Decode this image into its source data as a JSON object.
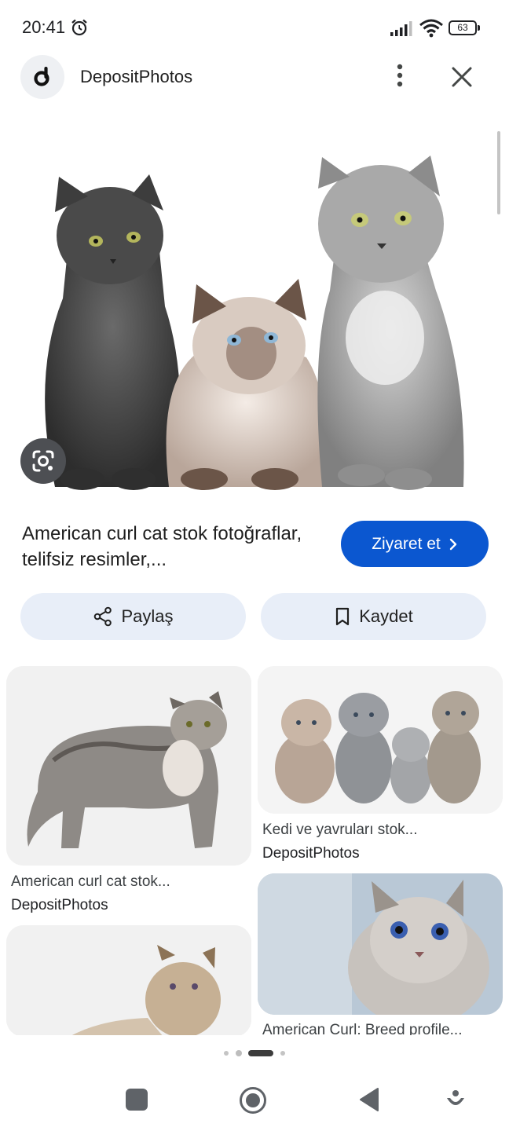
{
  "status_bar": {
    "time": "20:41",
    "battery": "63"
  },
  "header": {
    "site_name": "DepositPhotos",
    "logo_letter": "d"
  },
  "result": {
    "title": "American curl cat stok fotoğraflar, telifsiz resimler,...",
    "visit_label": "Ziyaret et",
    "share_label": "Paylaş",
    "save_label": "Kaydet"
  },
  "related": [
    {
      "title": "American curl cat stok...",
      "source": "DepositPhotos"
    },
    {
      "title": "Kedi ve yavruları stok...",
      "source": "DepositPhotos"
    },
    {
      "title": "American Curl: Breed profile...",
      "source": ""
    },
    {
      "title": "",
      "source": ""
    }
  ],
  "icons": {
    "alarm": "alarm-icon",
    "signal": "signal-icon",
    "wifi": "wifi-icon",
    "more": "more-vert-icon",
    "close": "close-icon",
    "lens": "lens-icon",
    "share": "share-icon",
    "save": "bookmark-icon",
    "chevron": "chevron-right-icon"
  },
  "colors": {
    "accent": "#0b57d0",
    "pill_bg": "#e8eef8"
  }
}
